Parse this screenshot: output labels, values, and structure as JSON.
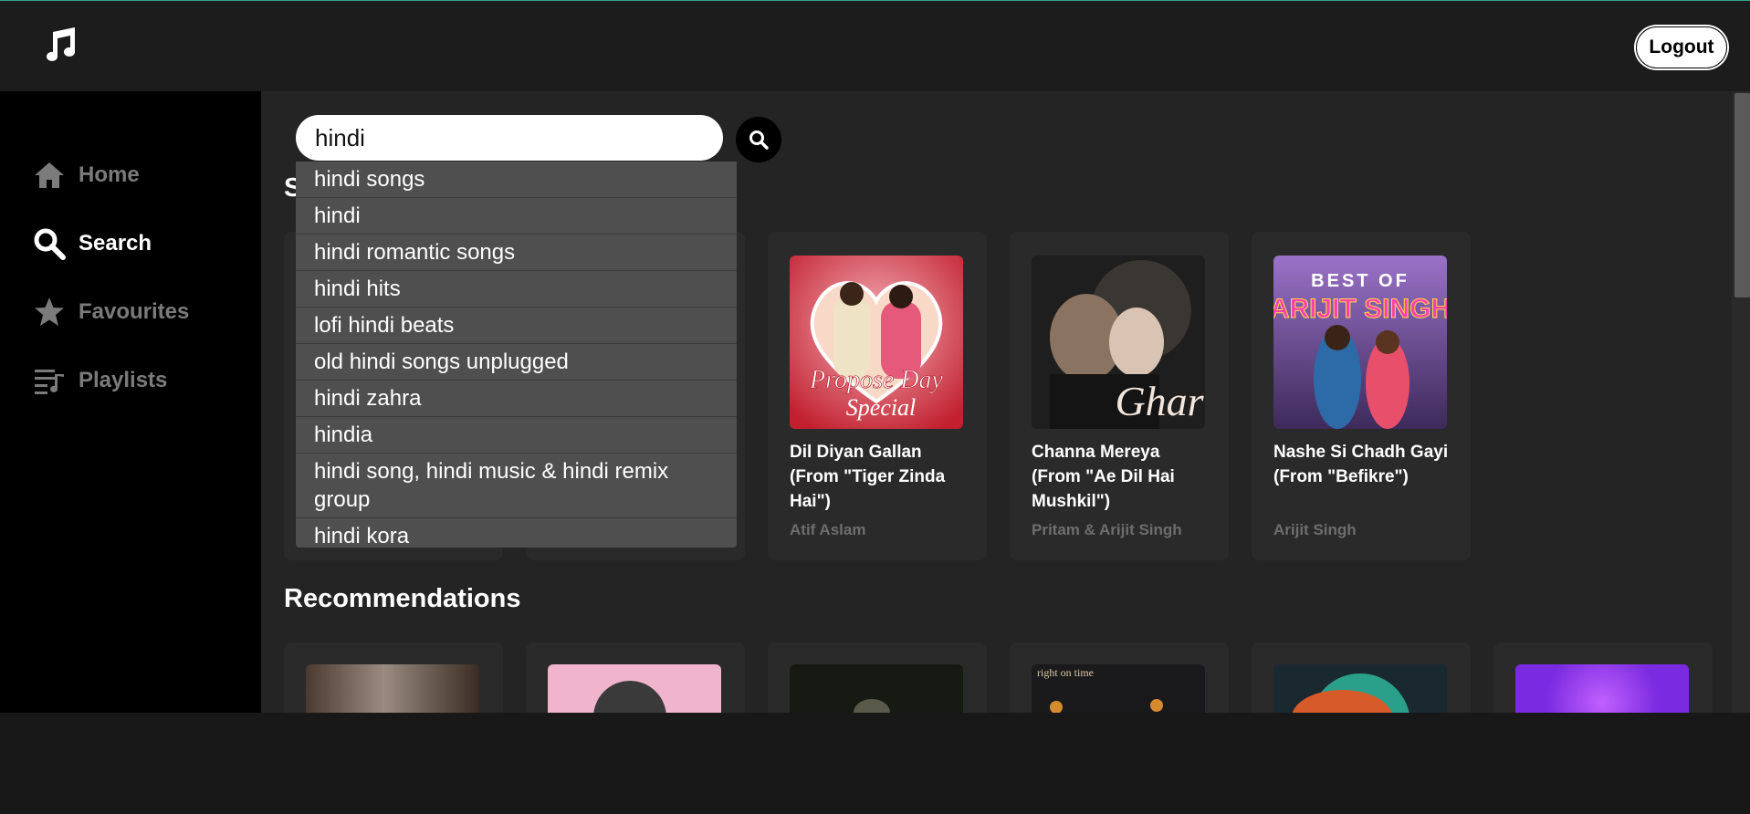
{
  "header": {
    "logout_label": "Logout"
  },
  "sidebar": {
    "items": [
      {
        "label": "Home",
        "icon": "home-icon",
        "active": false
      },
      {
        "label": "Search",
        "icon": "search-icon",
        "active": true
      },
      {
        "label": "Favourites",
        "icon": "star-icon",
        "active": false
      },
      {
        "label": "Playlists",
        "icon": "playlist-icon",
        "active": false
      }
    ]
  },
  "search": {
    "value": "hindi",
    "suggestions": [
      "hindi songs",
      "hindi",
      "hindi romantic songs",
      "hindi hits",
      "lofi hindi beats",
      "old hindi songs unplugged",
      "hindi zahra",
      "hindia",
      "hindi song, hindi music & hindi remix group",
      "hindi kora"
    ]
  },
  "results": {
    "title_initial": "S",
    "songs": [
      {
        "title": "Dil Diyan Gallan (From \"Tiger Zinda Hai\")",
        "artist": "Atif Aslam",
        "art_text": "Propose Day Special"
      },
      {
        "title": "Channa Mereya (From \"Ae Dil Hai Mushkil\")",
        "artist": "Pritam & Arijit Singh",
        "art_text": "Ghar"
      },
      {
        "title": "Nashe Si Chadh Gayi (From \"Befikre\")",
        "artist": "Arijit Singh",
        "art_text_1": "BEST OF",
        "art_text_2": "ARIJIT SINGH"
      }
    ]
  },
  "recommendations": {
    "title": "Recommendations",
    "art_text": "right on time"
  },
  "colors": {
    "accent": "#2fa58a",
    "sidebar_bg": "#000000",
    "main_bg": "#242424",
    "card_bg": "#2a2a2a"
  }
}
